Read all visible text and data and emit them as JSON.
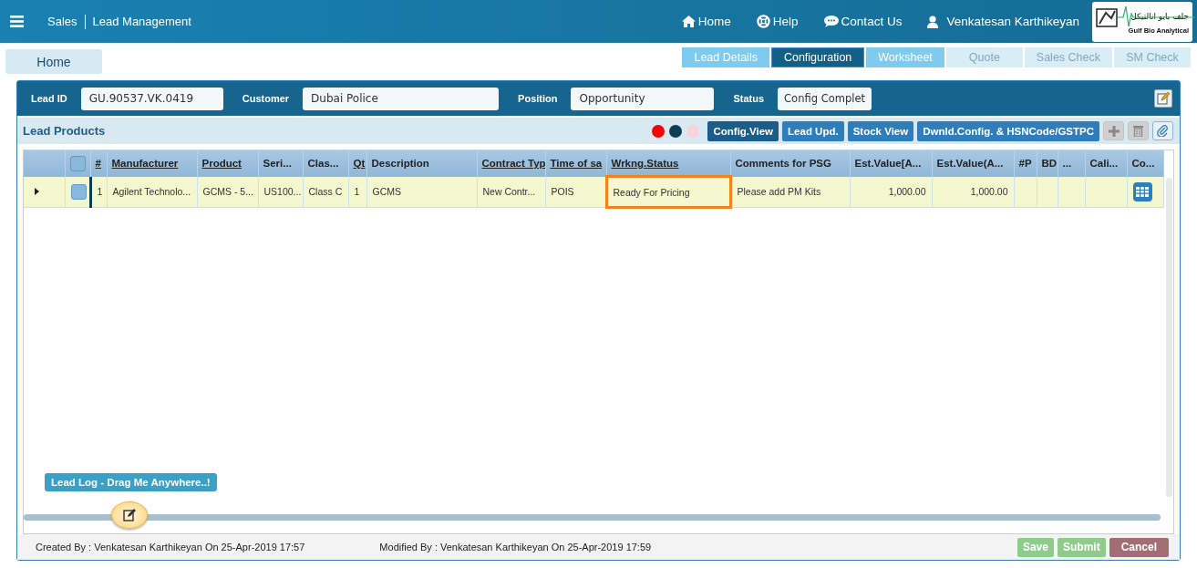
{
  "header": {
    "app": "Sales",
    "module": "Lead Management",
    "nav": [
      {
        "kind": "home",
        "label": "Home"
      },
      {
        "kind": "help",
        "label": "Help"
      },
      {
        "kind": "contact",
        "label": "Contact Us"
      },
      {
        "kind": "user",
        "label": "Venkatesan Karthikeyan"
      }
    ],
    "logo": {
      "arabic": "جلف بايو انالتيكل",
      "name": "Gulf Bio Analytical"
    }
  },
  "home_button": "Home",
  "tabs": [
    {
      "label": "Lead Details",
      "selected": false,
      "disabled": false
    },
    {
      "label": "Configuration",
      "selected": true,
      "disabled": false
    },
    {
      "label": "Worksheet",
      "selected": false,
      "disabled": false
    },
    {
      "label": "Quote",
      "selected": false,
      "disabled": true
    },
    {
      "label": "Sales Check",
      "selected": false,
      "disabled": true
    },
    {
      "label": "SM Check",
      "selected": false,
      "disabled": true
    }
  ],
  "lead": {
    "fields": [
      {
        "label": "Lead ID",
        "value": "GU.90537.VK.0419"
      },
      {
        "label": "Customer",
        "value": "Dubai Police"
      },
      {
        "label": "Position",
        "value": "Opportunity"
      },
      {
        "label": "Status",
        "value": "Config Complet"
      }
    ]
  },
  "products": {
    "title": "Lead Products",
    "dots": [
      {
        "color": "#ff0000"
      },
      {
        "color": "#0d3f52"
      },
      {
        "color": "#f6d4da"
      }
    ],
    "buttons": [
      {
        "label": "Config.View",
        "selected": true
      },
      {
        "label": "Lead Upd.",
        "selected": false
      },
      {
        "label": "Stock View",
        "selected": false
      },
      {
        "label": "Dwnld.Config. & HSNCode/GSTPC",
        "selected": false
      }
    ],
    "tools": [
      {
        "kind": "add",
        "disabled": true
      },
      {
        "kind": "delete",
        "disabled": true
      },
      {
        "kind": "attach",
        "disabled": false
      }
    ],
    "columns": [
      {
        "kind": "expander"
      },
      {
        "kind": "checkbox",
        "checked": false
      },
      {
        "kind": "text",
        "label": "#",
        "sortable": true
      },
      {
        "kind": "text",
        "label": "Manufacturer",
        "sortable": true
      },
      {
        "kind": "text",
        "label": "Product",
        "sortable": true
      },
      {
        "kind": "text",
        "label": "Seri...",
        "sortable": false
      },
      {
        "kind": "text",
        "label": "Clas...",
        "sortable": false
      },
      {
        "kind": "text",
        "label": "Qt",
        "sortable": true
      },
      {
        "kind": "text",
        "label": "Description",
        "sortable": false
      },
      {
        "kind": "text",
        "label": "Contract Typ",
        "sortable": true
      },
      {
        "kind": "text",
        "label": "Time of sa",
        "sortable": true
      },
      {
        "kind": "text",
        "label": "Wrkng.Status",
        "sortable": true
      },
      {
        "kind": "text",
        "label": "Comments for PSG",
        "sortable": false
      },
      {
        "kind": "text",
        "label": "Est.Value[A...",
        "sortable": false
      },
      {
        "kind": "text",
        "label": "Est.Value(A...",
        "sortable": false
      },
      {
        "kind": "text",
        "label": "#P",
        "sortable": false
      },
      {
        "kind": "text",
        "label": "BD",
        "sortable": false
      },
      {
        "kind": "text",
        "label": "...",
        "sortable": false
      },
      {
        "kind": "text",
        "label": "Cali...",
        "sortable": false
      },
      {
        "kind": "text",
        "label": "Co...",
        "sortable": false
      }
    ],
    "rows": [
      {
        "cells": [
          {
            "kind": "expander"
          },
          {
            "kind": "checkbox",
            "checked": false
          },
          {
            "kind": "text",
            "text": "1",
            "highlighted": false
          },
          {
            "kind": "text",
            "text": "Agilent Technolo...",
            "highlighted": false
          },
          {
            "kind": "text",
            "text": "GCMS - 5...",
            "highlighted": false
          },
          {
            "kind": "text",
            "text": "US100...",
            "highlighted": false
          },
          {
            "kind": "text",
            "text": "Class C",
            "highlighted": false
          },
          {
            "kind": "text",
            "text": "1",
            "highlighted": false
          },
          {
            "kind": "text",
            "text": "GCMS",
            "highlighted": false
          },
          {
            "kind": "text",
            "text": "New Contr...",
            "highlighted": false
          },
          {
            "kind": "text",
            "text": "POIS",
            "highlighted": false
          },
          {
            "kind": "text",
            "text": "Ready For Pricing",
            "highlighted": true
          },
          {
            "kind": "text",
            "text": "Please add PM Kits",
            "highlighted": false
          },
          {
            "kind": "number",
            "text": "1,000.00",
            "highlighted": false
          },
          {
            "kind": "number",
            "text": "1,000.00",
            "highlighted": false
          },
          {
            "kind": "empty"
          },
          {
            "kind": "empty"
          },
          {
            "kind": "empty"
          },
          {
            "kind": "empty"
          },
          {
            "kind": "grid-button"
          }
        ]
      }
    ]
  },
  "lead_log": {
    "tooltip": "Lead Log - Drag Me Anywhere..!"
  },
  "footer": {
    "created": "Created By : Venkatesan Karthikeyan On 25-Apr-2019 17:57",
    "modified": "Modified By : Venkatesan Karthikeyan On 25-Apr-2019 17:59",
    "buttons": [
      {
        "label": "Save",
        "kind": "save",
        "disabled": true
      },
      {
        "label": "Submit",
        "kind": "save",
        "disabled": true
      },
      {
        "label": "Cancel",
        "kind": "cancel",
        "disabled": false
      }
    ]
  }
}
